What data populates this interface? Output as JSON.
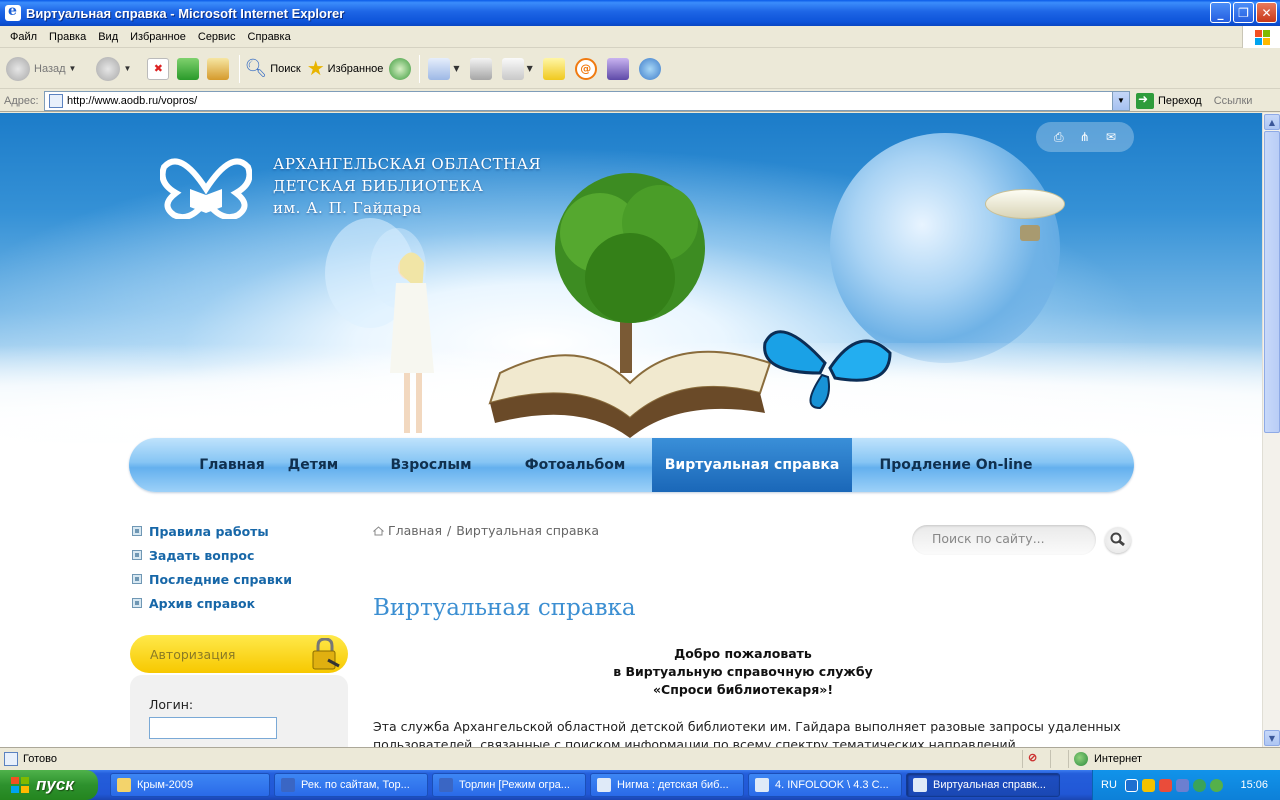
{
  "window": {
    "title": "Виртуальная справка - Microsoft Internet Explorer",
    "buttons": [
      "_",
      "❐",
      "✕"
    ]
  },
  "menu": [
    "Файл",
    "Правка",
    "Вид",
    "Избранное",
    "Сервис",
    "Справка"
  ],
  "toolbar": {
    "back": "Назад",
    "search": "Поиск",
    "favorites": "Избранное"
  },
  "address": {
    "label": "Адрес:",
    "url": "http://www.aodb.ru/vopros/",
    "go": "Переход",
    "links": "Ссылки"
  },
  "site": {
    "logo_line1": "АРХАНГЕЛЬСКАЯ ОБЛАСТНАЯ",
    "logo_line2": "ДЕТСКАЯ БИБЛИОТЕКА",
    "logo_line3": "им. А. П. Гайдара",
    "nav": [
      {
        "label": "Главная",
        "active": false
      },
      {
        "label": "Детям",
        "active": false
      },
      {
        "label": "Взрослым",
        "active": false
      },
      {
        "label": "Фотоальбом",
        "active": false
      },
      {
        "label": "Виртуальная справка",
        "active": true
      },
      {
        "label": "Продление On-line",
        "active": false
      }
    ],
    "side_links": [
      "Правила работы",
      "Задать вопрос",
      "Последние справки",
      "Архив справок"
    ],
    "auth_title": "Авторизация",
    "login_label": "Логин:",
    "breadcrumb_home": "Главная",
    "breadcrumb_sep": "/",
    "breadcrumb_current": "Виртуальная справка",
    "search_placeholder": "Поиск по сайту...",
    "page_title": "Виртуальная справка",
    "welcome_1": "Добро пожаловать",
    "welcome_2": "в Виртуальную справочную службу",
    "welcome_3": "«Спроси библиотекаря»!",
    "paragraph": "Эта служба Архангельской областной детской библиотеки им. Гайдара выполняет разовые запросы удаленных пользователей, связанные с поиском информации по всему спектру тематических направлений."
  },
  "status": {
    "text": "Готово",
    "zone": "Интернет"
  },
  "taskbar": {
    "start": "пуск",
    "tasks": [
      {
        "label": "Крым-2009",
        "active": false
      },
      {
        "label": "Рек. по сайтам, Тор...",
        "active": false
      },
      {
        "label": "Торлин [Режим огра...",
        "active": false
      },
      {
        "label": "Нигма : детская биб...",
        "active": false
      },
      {
        "label": "4. INFOLOOK \\ 4.3 С...",
        "active": false
      },
      {
        "label": "Виртуальная справк...",
        "active": true
      }
    ],
    "lang": "RU",
    "clock": "15:06"
  }
}
